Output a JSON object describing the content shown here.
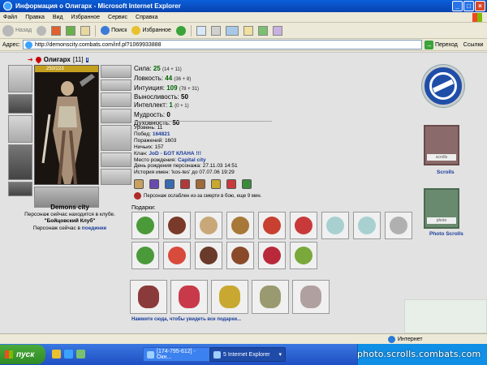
{
  "window": {
    "title": "Информация о Олигарх - Microsoft Internet Explorer"
  },
  "menu": [
    "Файл",
    "Правка",
    "Вид",
    "Избранное",
    "Сервис",
    "Справка"
  ],
  "toolbar": {
    "back": "Назад",
    "search": "Поиск",
    "favorites": "Избранное"
  },
  "address": {
    "label": "Адрес:",
    "url": "http://demonscity.combats.com/inf.pl?1069933888",
    "go": "Переход",
    "links": "Ссылки"
  },
  "character": {
    "name": "Олигарх",
    "level": "[11]",
    "level_badge": "i",
    "hp": "250/223",
    "hp_fraction": 1.0,
    "city": "Demons city",
    "club_line1": "Персонаж сейчас находится в клубе.",
    "club_name": "\"Бойцовский Клуб\"",
    "battle_prefix": "Персонаж сейчас в",
    "battle_link": "поединке"
  },
  "stats": [
    {
      "label": "Сила:",
      "value": "25",
      "extra": "(14 + 11)",
      "green": true
    },
    {
      "label": "Ловкость:",
      "value": "44",
      "extra": "(36 + 8)",
      "green": true
    },
    {
      "label": "Интуиция:",
      "value": "109",
      "extra": "(78 + 31)",
      "green": true
    },
    {
      "label": "Выносливость:",
      "value": "50",
      "extra": "",
      "green": false
    },
    {
      "label": "Интеллект:",
      "value": "1",
      "extra": "(0 + 1)",
      "green": true
    },
    {
      "label": "Мудрость:",
      "value": "0",
      "extra": "",
      "green": false
    },
    {
      "label": "Духовность:",
      "value": "50",
      "extra": "",
      "green": false
    }
  ],
  "info": {
    "level": "Уровень: 11",
    "wins_label": "Побед:",
    "wins": "164821",
    "losses": "Поражений: 1603",
    "draws": "Ничьих: 157",
    "clan_label": "Клан:",
    "clan": "JoD - БОТ КЛАНА !!!",
    "birthplace_label": "Место рождения:",
    "birthplace": "Capital city",
    "birthday": "День рождения персонажа: 27.11.03 14:51",
    "names_history": "История имен: 'kos-tes' до 07.07.06 19:29"
  },
  "weakness": "Персонаж ослаблен из-за смерти в бою, еще 9 мин.",
  "gifts": {
    "label": "Подарки:",
    "more": "Нажмите сюда, чтобы увидеть все подарки...",
    "gift_colors": [
      "#4a9a3a",
      "#7a3a2a",
      "#c8a878",
      "#a87838",
      "#c84030",
      "#c83a3a",
      "#a8d0d0",
      "#a8d0d0",
      "#b0b0b0",
      "#4a9a3a",
      "#d84a3a",
      "#6a3a2a",
      "#8a4a2a",
      "#b82a3a",
      "#7aa83a"
    ],
    "big_colors": [
      "#8a3a3a",
      "#c83a4a",
      "#c8a830",
      "#9a9a70",
      "#b0a0a0"
    ]
  },
  "right": {
    "scrolls": "Scrolls",
    "photo_scrolls": "Photo Scrolls",
    "banner1_text": "scrolls",
    "banner2_text": "photo"
  },
  "status": {
    "zone": "Интернет"
  },
  "taskbar": {
    "start": "пуск",
    "task1": "[174-795-612] - Окн...",
    "task2": "5 Internet Explorer",
    "watermark": "photo.scrolls.combats.com"
  }
}
